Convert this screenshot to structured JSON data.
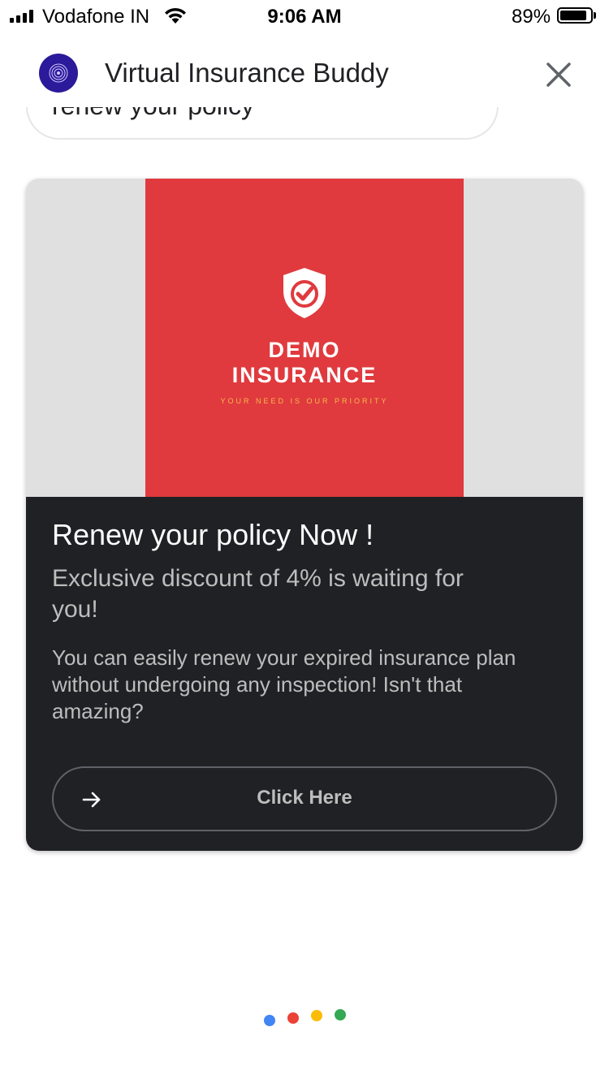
{
  "status_bar": {
    "carrier": "Vodafone IN",
    "time": "9:06 AM",
    "battery_percent": "89%",
    "battery_level": 0.89
  },
  "header": {
    "title": "Virtual Insurance Buddy",
    "avatar_icon": "bot-logo-icon",
    "close_icon": "close-icon"
  },
  "previous_message": {
    "text": "renew your policy"
  },
  "card": {
    "image": {
      "brand_line1": "DEMO",
      "brand_line2": "INSURANCE",
      "tagline": "YOUR NEED IS OUR PRIORITY",
      "icon": "shield-check-icon",
      "panel_color": "#e03a3e",
      "tagline_color": "#f6b94b"
    },
    "title": "Renew your policy Now !",
    "subtitle": "Exclusive discount of 4% is waiting for you!",
    "description": "You can easily renew your expired insurance plan without undergoing any inspection! Isn't that amazing?",
    "button_label": "Click Here",
    "button_icon": "arrow-right-icon"
  },
  "typing_indicator": {
    "colors": [
      "#4285f4",
      "#ea4335",
      "#fbbc05",
      "#34a853"
    ]
  }
}
